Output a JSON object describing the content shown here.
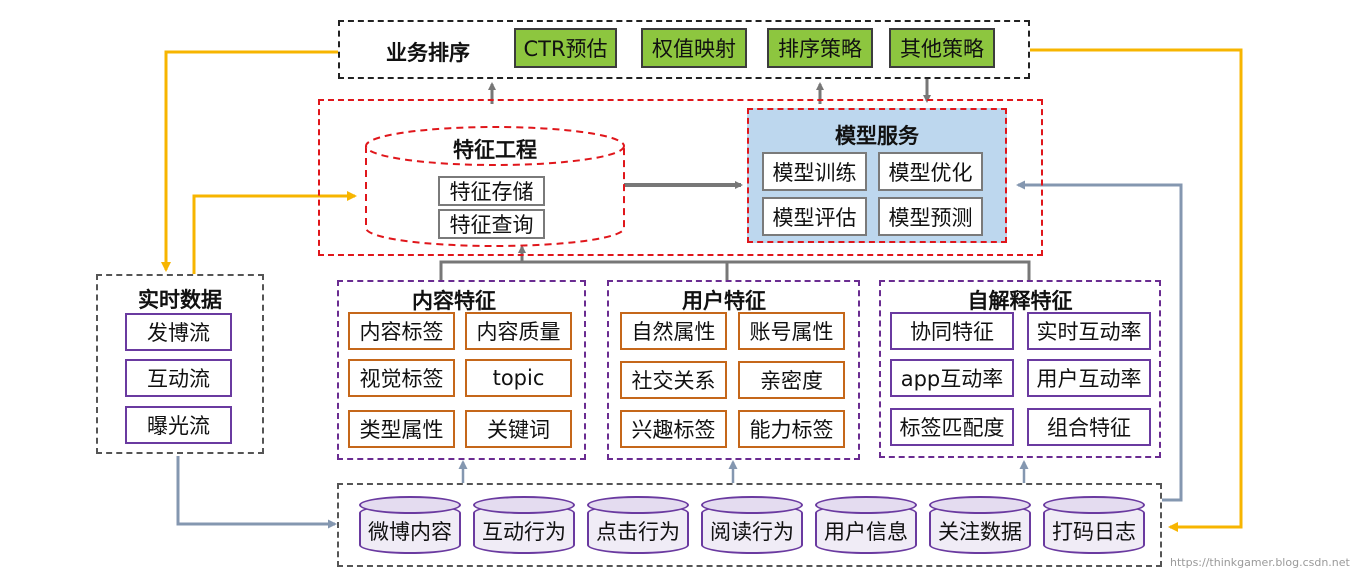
{
  "business": {
    "title": "业务排序",
    "items": [
      "CTR预估",
      "权值映射",
      "排序策略",
      "其他策略"
    ]
  },
  "feature_eng": {
    "title": "特征工程",
    "items": [
      "特征存储",
      "特征查询"
    ]
  },
  "model_service": {
    "title": "模型服务",
    "items": [
      "模型训练",
      "模型优化",
      "模型评估",
      "模型预测"
    ]
  },
  "realtime": {
    "title": "实时数据",
    "items": [
      "发博流",
      "互动流",
      "曝光流"
    ]
  },
  "content": {
    "title": "内容特征",
    "items": [
      "内容标签",
      "内容质量",
      "视觉标签",
      "topic",
      "类型属性",
      "关键词"
    ]
  },
  "user": {
    "title": "用户特征",
    "items": [
      "自然属性",
      "账号属性",
      "社交关系",
      "亲密度",
      "兴趣标签",
      "能力标签"
    ]
  },
  "self_explain": {
    "title": "自解释特征",
    "items": [
      "协同特征",
      "实时互动率",
      "app互动率",
      "用户互动率",
      "标签匹配度",
      "组合特征"
    ]
  },
  "sources": {
    "items": [
      "微博内容",
      "互动行为",
      "点击行为",
      "阅读行为",
      "用户信息",
      "关注数据",
      "打码日志"
    ]
  },
  "watermark": "https://thinkgamer.blog.csdn.net",
  "colors": {
    "feedback": "#f7b500",
    "flow": "#8497b0",
    "arrow": "#777777"
  }
}
